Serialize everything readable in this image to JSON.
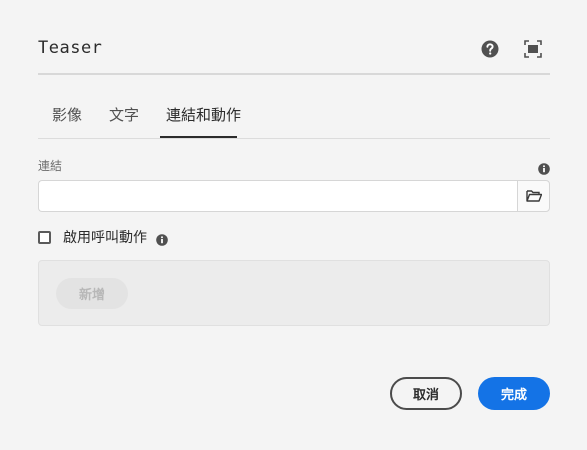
{
  "dialog": {
    "title": "Teaser"
  },
  "header": {
    "icons": [
      {
        "name": "help-icon",
        "color": "#505050"
      },
      {
        "name": "fullscreen-icon",
        "color": "#505050"
      }
    ]
  },
  "tabs": [
    {
      "label": "影像",
      "selected": false
    },
    {
      "label": "文字",
      "selected": false
    },
    {
      "label": "連結和動作",
      "selected": true
    }
  ],
  "link": {
    "label": "連結",
    "value": "",
    "placeholder": "",
    "info_icon": "info-icon",
    "browse_icon": "folder-icon"
  },
  "cta": {
    "checkbox_label": "啟用呼叫動作",
    "checked": false,
    "info_icon": "info-icon",
    "add_label": "新增"
  },
  "footer": {
    "cancel_label": "取消",
    "done_label": "完成"
  },
  "colors": {
    "background": "#f4f4f4",
    "primary": "#1473e6",
    "text": "#2c2c2c"
  }
}
